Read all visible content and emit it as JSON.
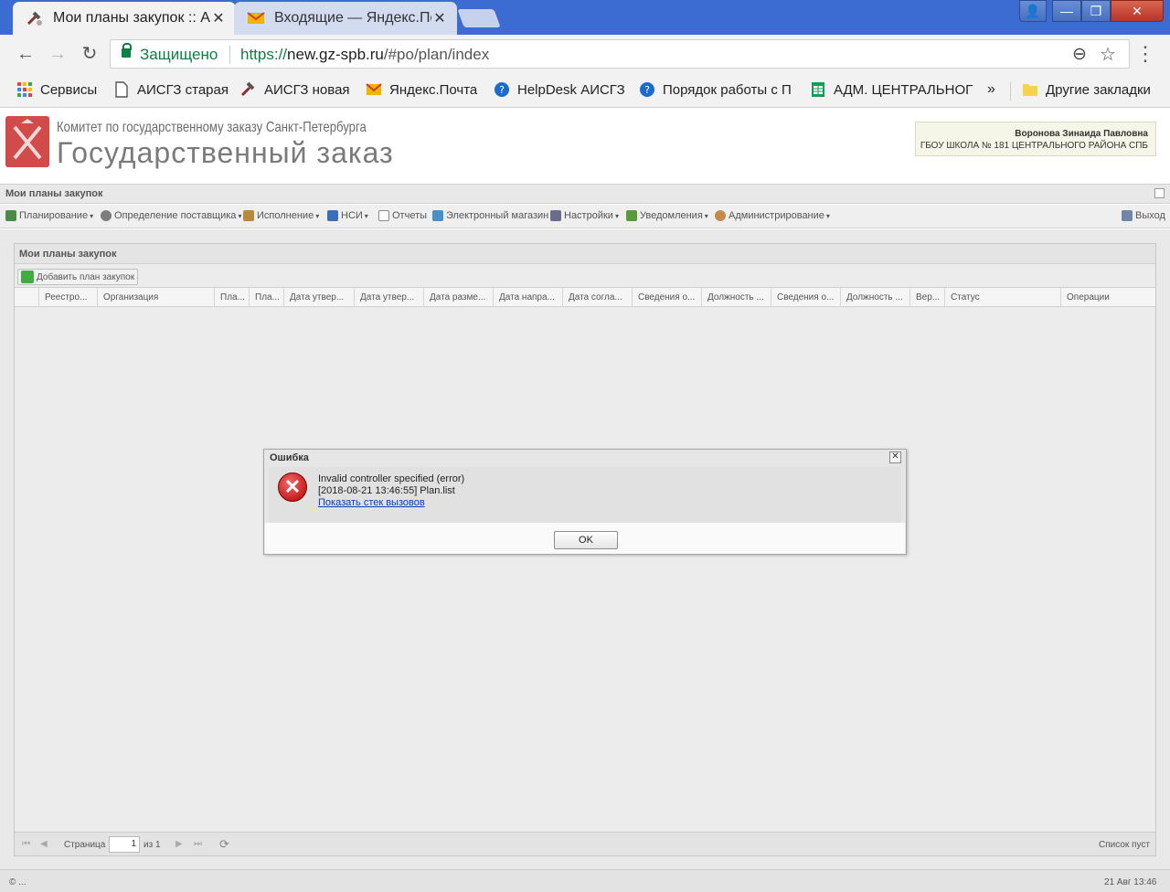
{
  "browser": {
    "tabs": [
      {
        "title": "Мои планы закупок :: АИ",
        "active": true
      },
      {
        "title": "Входящие — Яндекс.Поч",
        "active": false
      }
    ],
    "tab_close_glyph": "✕",
    "window_controls": {
      "user": "👤",
      "minimize": "—",
      "restore": "❐",
      "close": "✕"
    },
    "nav": {
      "back": "←",
      "forward": "→",
      "reload": "↻",
      "menu": "⋮"
    },
    "omnibox": {
      "secure_label": "Защищено",
      "url_scheme": "https://",
      "url_host": "new.gz-spb.ru",
      "url_path": "/#po/plan/index",
      "zoom_icon": "⊖",
      "star_icon": "☆"
    },
    "bookmarks": [
      {
        "label": "Сервисы",
        "icon": "apps-icon",
        "color": "#e94235"
      },
      {
        "label": "АИСГЗ старая",
        "icon": "page-icon",
        "color": "#555555"
      },
      {
        "label": "АИСГЗ новая",
        "icon": "tools-icon",
        "color": "#9e3a3a"
      },
      {
        "label": "Яндекс.Почта",
        "icon": "mail-icon",
        "color": "#f2b400"
      },
      {
        "label": "HelpDesk АИСГЗ",
        "icon": "help-icon",
        "color": "#1c6ad0"
      },
      {
        "label": "Порядок работы с П",
        "icon": "help-icon",
        "color": "#1c6ad0"
      },
      {
        "label": "АДМ. ЦЕНТРАЛЬНОГ",
        "icon": "sheet-icon",
        "color": "#0f9d58"
      }
    ],
    "bookmarks_more": "»",
    "other_bookmarks": "Другие закладки"
  },
  "app": {
    "brand_line1": "Комитет по государственному заказу Санкт-Петербурга",
    "brand_line2": "Государственный заказ",
    "user": {
      "name": "Воронова Зинаида Павловна",
      "org": "ГБОУ ШКОЛА № 181 ЦЕНТРАЛЬНОГО РАЙОНА СПБ"
    },
    "main_header": "Мои планы закупок",
    "menu": [
      {
        "label": "Планирование",
        "dropdown": true,
        "color": "#4a8a4a"
      },
      {
        "label": "Определение поставщика",
        "dropdown": true,
        "color": "#7d7d7d"
      },
      {
        "label": "Исполнение",
        "dropdown": true,
        "color": "#b58a3d"
      },
      {
        "label": "НСИ",
        "dropdown": true,
        "color": "#3d6eb5"
      },
      {
        "label": "Отчеты",
        "dropdown": false,
        "color": "#8a8a8a"
      },
      {
        "label": "Электронный магазин",
        "dropdown": false,
        "color": "#4a90c8"
      },
      {
        "label": "Настройки",
        "dropdown": true,
        "color": "#6b6b8a"
      },
      {
        "label": "Уведомления",
        "dropdown": true,
        "color": "#5a9a3a"
      },
      {
        "label": "Администрирование",
        "dropdown": true,
        "color": "#c88a4a"
      }
    ],
    "dropdown_arrow": "▾",
    "logout": "Выход",
    "panel_title": "Мои планы закупок",
    "add_button": "Добавить план закупок",
    "columns": [
      "Реестро...",
      "Организация",
      "Пла...",
      "Пла...",
      "Дата утвер...",
      "Дата утвер...",
      "Дата разме...",
      "Дата напра...",
      "Дата согла...",
      "Сведения о...",
      "Должность ...",
      "Сведения о...",
      "Должность ...",
      "Вер...",
      "Статус",
      "Операции"
    ],
    "pager": {
      "first": "⏮",
      "prev": "◀",
      "next": "▶",
      "last": "⏭",
      "refresh": "⟳",
      "page_label": "Страница",
      "page_value": "1",
      "of_label": "из 1",
      "empty": "Список пуст"
    },
    "status_left": "© ...",
    "status_right": "21 Авг 13:46"
  },
  "dialog": {
    "title": "Ошибка",
    "close_glyph": "✕",
    "icon_glyph": "✕",
    "line1": "Invalid controller specified (error)",
    "line2": "[2018-08-21 13:46:55] Plan.list",
    "link": "Показать стек вызовов",
    "ok": "OK"
  }
}
